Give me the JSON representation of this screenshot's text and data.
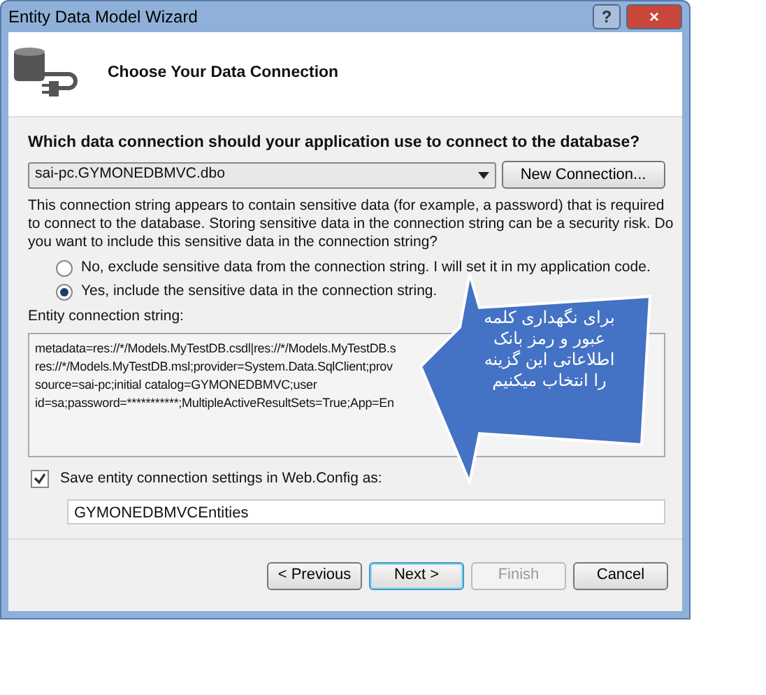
{
  "window": {
    "title": "Entity Data Model Wizard",
    "controls": [
      "?",
      "×"
    ]
  },
  "header": {
    "title": "Choose Your Data Connection"
  },
  "question": "Which data connection should your application use to connect to the database?",
  "connection": {
    "value": "sai-pc.GYMONEDBMVC.dbo",
    "button": "New Connection..."
  },
  "warning": "This connection string appears to contain sensitive data (for example, a password) that is required to connect to the database. Storing sensitive data in the connection string can be a security risk. Do you want to include this sensitive data in the connection string?",
  "options": [
    {
      "label": "No, exclude sensitive data from the connection string. I will set it in my application code.",
      "selected": false
    },
    {
      "label": "Yes, include the sensitive data in the connection string.",
      "selected": true
    }
  ],
  "entity_string": {
    "label": "Entity connection string:",
    "lines": [
      "metadata=res://*/Models.MyTestDB.csdl|res://*/Models.MyTestDB.s",
      "res://*/Models.MyTestDB.msl;provider=System.Data.SqlClient;prov",
      "source=sai-pc;initial catalog=GYMONEDBMVC;user",
      "id=sa;password=***********;MultipleActiveResultSets=True;App=En"
    ]
  },
  "save": {
    "label": "Save entity connection settings in Web.Config as:",
    "checked": true,
    "value": "GYMONEDBMVCEntities"
  },
  "buttons": [
    {
      "label": "< Previous",
      "disabled": false,
      "default": false
    },
    {
      "label": "Next >",
      "disabled": false,
      "default": true
    },
    {
      "label": "Finish",
      "disabled": true,
      "default": false
    },
    {
      "label": "Cancel",
      "disabled": false,
      "default": false
    }
  ],
  "callout": {
    "lines": [
      "برای نگهداری کلمه",
      "عبور و رمز بانک",
      "اطلاعاتی این گزینه",
      "را انتخاب میکنیم"
    ]
  }
}
